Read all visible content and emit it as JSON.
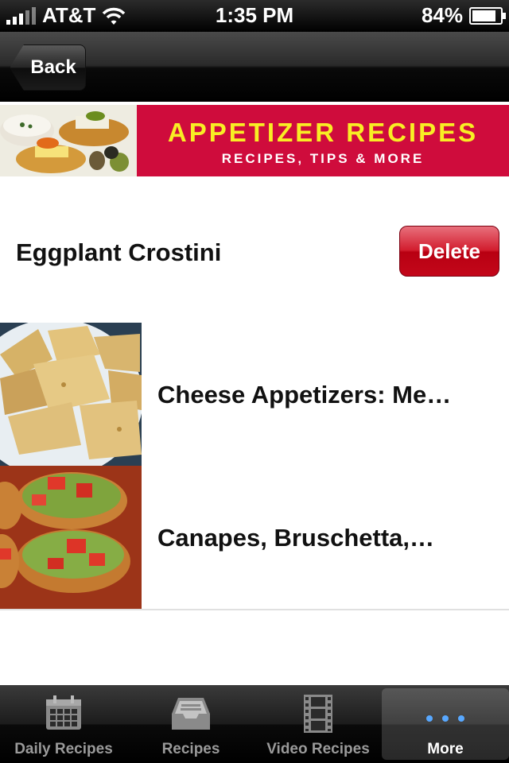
{
  "status_bar": {
    "carrier": "AT&T",
    "time": "1:35 PM",
    "battery_percent": "84%",
    "battery_level": 0.84
  },
  "nav": {
    "back_label": "Back"
  },
  "banner": {
    "title": "APPETIZER RECIPES",
    "subtitle": "RECIPES, TIPS & MORE",
    "accent_color": "#cf0c3c",
    "title_color": "#f8ee24"
  },
  "list": {
    "items": [
      {
        "title": "Eggplant Crostini",
        "has_image": false,
        "delete_label": "Delete"
      },
      {
        "title": "Cheese Appetizers: Me…",
        "has_image": true,
        "image": "fried-pastry-photo"
      },
      {
        "title": "Canapes, Bruschetta,…",
        "has_image": true,
        "image": "bruschetta-photo"
      }
    ]
  },
  "tab_bar": {
    "tabs": [
      {
        "label": "Daily Recipes",
        "icon": "calendar-icon",
        "active": false
      },
      {
        "label": "Recipes",
        "icon": "inbox-tray-icon",
        "active": false
      },
      {
        "label": "Video Recipes",
        "icon": "film-strip-icon",
        "active": false
      },
      {
        "label": "More",
        "icon": "more-dots-icon",
        "active": true
      }
    ]
  }
}
